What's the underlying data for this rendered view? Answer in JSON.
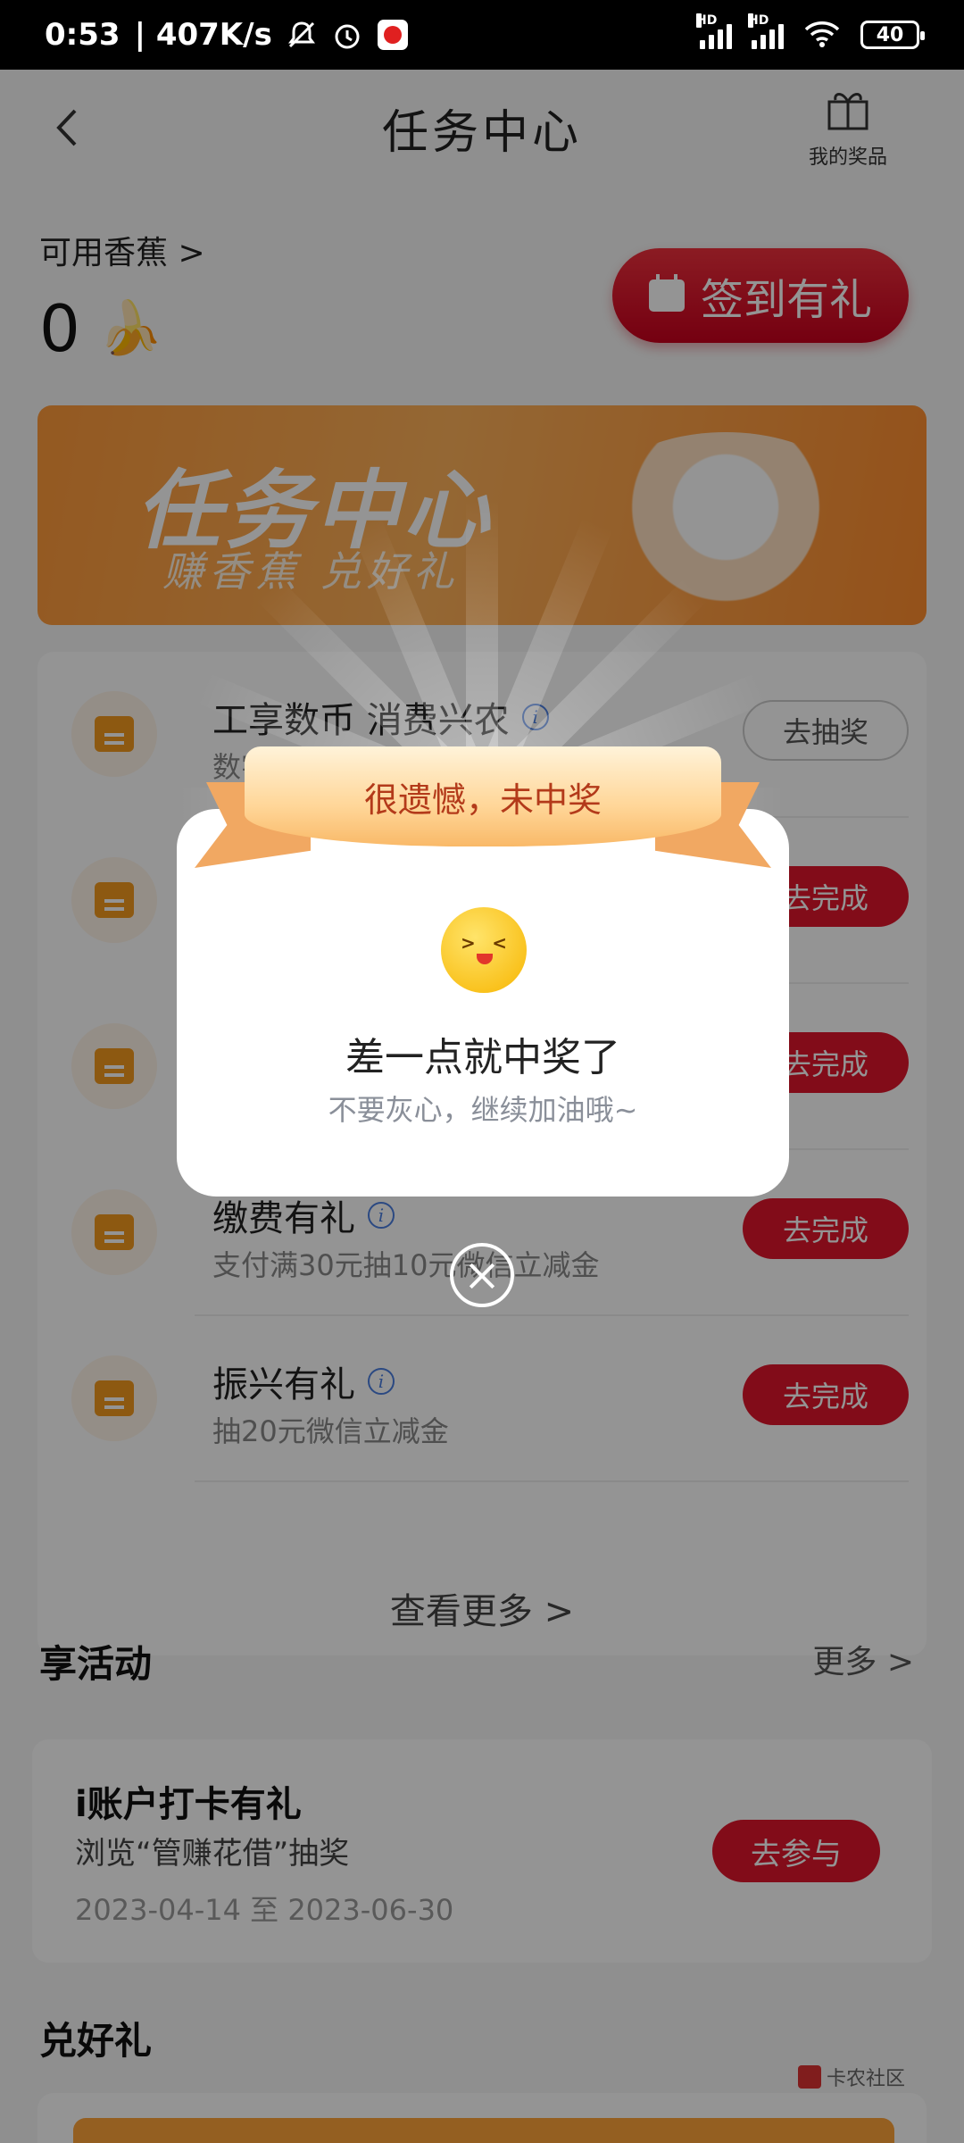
{
  "status_bar": {
    "time": "0:53",
    "speed": "| 407K/s",
    "battery": "40",
    "signal_label": "HD"
  },
  "header": {
    "title": "任务中心",
    "prize_label": "我的奖品"
  },
  "balance": {
    "label": "可用香蕉 >",
    "value": "0"
  },
  "signin_button": "签到有礼",
  "banner": {
    "title": "任务中心",
    "subtitle": "赚香蕉 兑好礼"
  },
  "tasks": [
    {
      "title": "工享数币 消费兴农",
      "subtitle": "数字人民币消费",
      "button": "去抽奖",
      "style": "ghost"
    },
    {
      "title": "",
      "subtitle": "",
      "button": "去完成",
      "style": "primary"
    },
    {
      "title": "",
      "subtitle": "",
      "button": "去完成",
      "style": "primary"
    },
    {
      "title": "缴费有礼",
      "subtitle": "支付满30元抽10元微信立减金",
      "button": "去完成",
      "style": "primary"
    },
    {
      "title": "振兴有礼",
      "subtitle": "抽20元微信立减金",
      "button": "去完成",
      "style": "primary"
    }
  ],
  "view_more": "查看更多 >",
  "activities_section": {
    "title": "享活动",
    "more": "更多 >"
  },
  "activity": {
    "name": "i账户打卡有礼",
    "desc": "浏览“管赚花借”抽奖",
    "date": "2023-04-14 至 2023-06-30",
    "button": "去参与"
  },
  "gifts_section": {
    "title": "兑好礼"
  },
  "watermark": "卡农社区",
  "dialog": {
    "ribbon_text": "很遗憾，未中奖",
    "title": "差一点就中奖了",
    "subtitle": "不要灰心，继续加油哦~"
  },
  "colors": {
    "primary_red": "#e0162b",
    "banner_orange": "#ff9a3a",
    "ribbon_text": "#b33a1a"
  }
}
